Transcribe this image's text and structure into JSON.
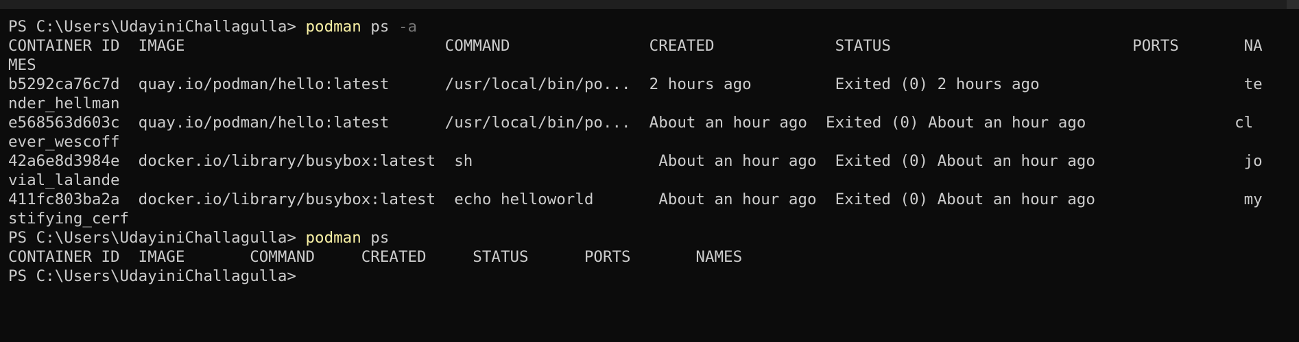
{
  "terminal": {
    "lines": [
      {
        "prompt": "PS C:\\Users\\UdayiniChallagulla> ",
        "cmd": "podman",
        "args": " ps ",
        "flag": "-a"
      },
      {
        "text": "CONTAINER ID  IMAGE                            COMMAND               CREATED             STATUS                          PORTS       NA"
      },
      {
        "text": "MES"
      },
      {
        "text": "b5292ca76c7d  quay.io/podman/hello:latest      /usr/local/bin/po...  2 hours ago         Exited (0) 2 hours ago                      te"
      },
      {
        "text": "nder_hellman"
      },
      {
        "text": "e568563d603c  quay.io/podman/hello:latest      /usr/local/bin/po...  About an hour ago  Exited (0) About an hour ago                cl"
      },
      {
        "text": "ever_wescoff"
      },
      {
        "text": "42a6e8d3984e  docker.io/library/busybox:latest  sh                    About an hour ago  Exited (0) About an hour ago                jo"
      },
      {
        "text": "vial_lalande"
      },
      {
        "text": "411fc803ba2a  docker.io/library/busybox:latest  echo helloworld       About an hour ago  Exited (0) About an hour ago                my"
      },
      {
        "text": "stifying_cerf"
      },
      {
        "prompt": "PS C:\\Users\\UdayiniChallagulla> ",
        "cmd": "podman",
        "args": " ps",
        "flag": ""
      },
      {
        "text": "CONTAINER ID  IMAGE       COMMAND     CREATED     STATUS      PORTS       NAMES"
      },
      {
        "prompt": "PS C:\\Users\\UdayiniChallagulla>",
        "cmd": "",
        "args": "",
        "flag": ""
      }
    ]
  },
  "colors": {
    "background": "#0c0c0c",
    "foreground": "#cccccc",
    "command": "#f9f1a5",
    "flag": "#767676"
  }
}
